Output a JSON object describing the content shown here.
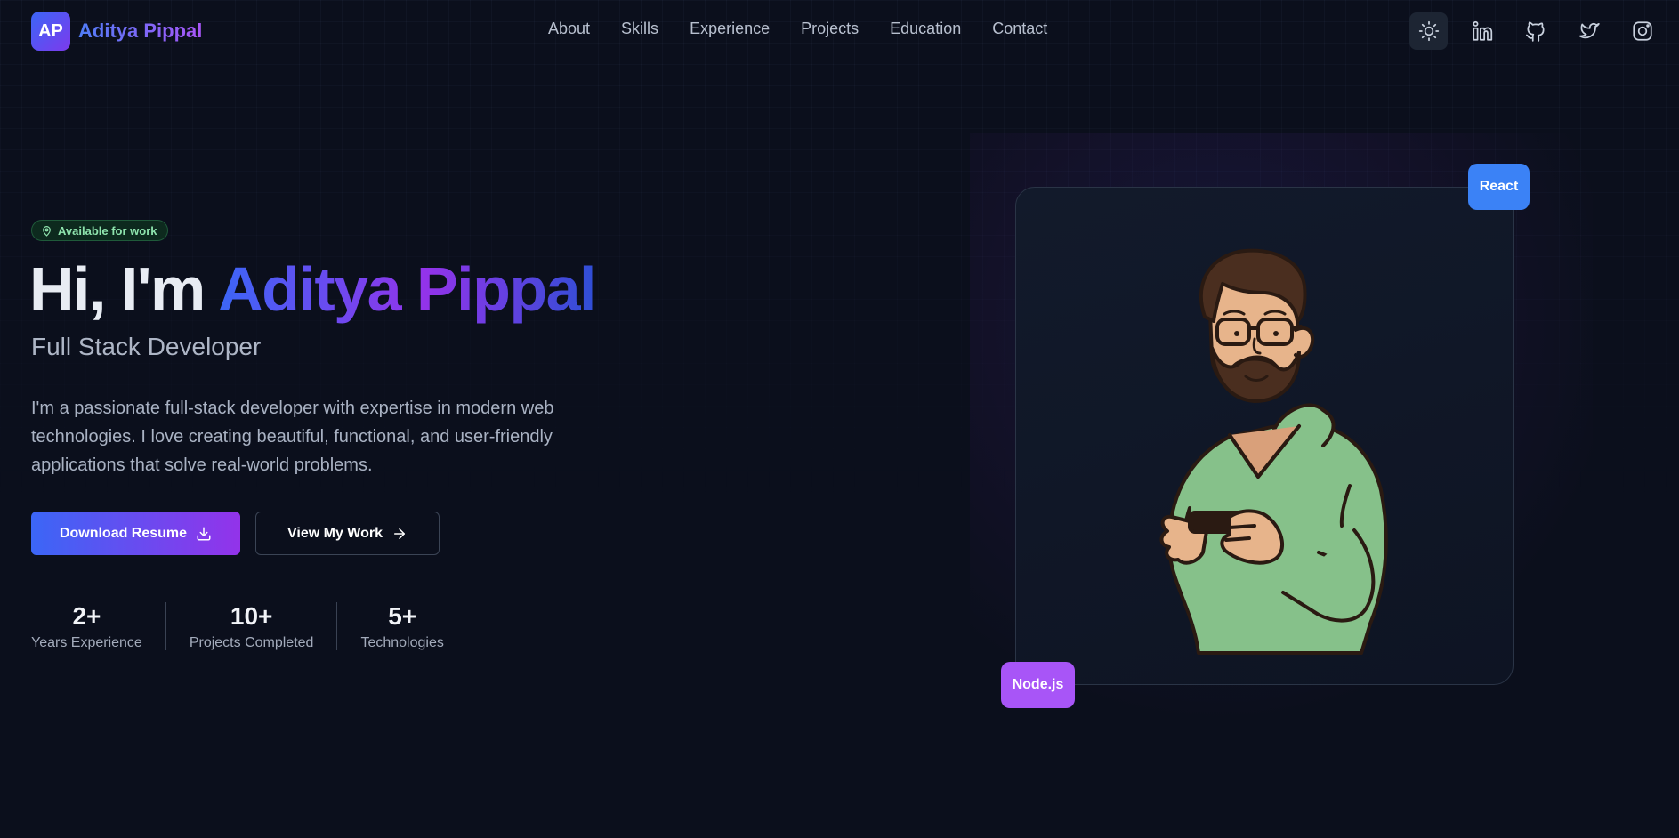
{
  "brand": {
    "initials": "AP",
    "name": "Aditya Pippal"
  },
  "nav": {
    "links": [
      "About",
      "Skills",
      "Experience",
      "Projects",
      "Education",
      "Contact"
    ],
    "icons": [
      "sun-icon",
      "linkedin-icon",
      "github-icon",
      "twitter-icon",
      "instagram-icon"
    ]
  },
  "hero": {
    "badge": "Available for work",
    "greeting": "Hi, I'm ",
    "name": "Aditya Pippal",
    "subtitle": "Full Stack Developer",
    "description": "I'm a passionate full-stack developer with expertise in modern web technologies. I love creating beautiful, functional, and user-friendly applications that solve real-world problems.",
    "primary_button": "Download Resume",
    "secondary_button": "View My Work"
  },
  "stats": [
    {
      "value": "2+",
      "label": "Years Experience"
    },
    {
      "value": "10+",
      "label": "Projects Completed"
    },
    {
      "value": "5+",
      "label": "Technologies"
    }
  ],
  "tags": {
    "react": "React",
    "node": "Node.js"
  },
  "colors": {
    "background": "#0b0f1c",
    "accent_blue": "#3b66f6",
    "accent_purple": "#9333ea",
    "react_tag": "#3b82f6",
    "node_tag": "#a855f7",
    "available_green": "#8ee3ad"
  }
}
